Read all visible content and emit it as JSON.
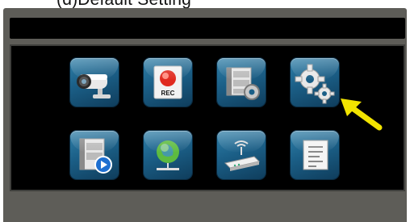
{
  "caption": "(d)Default Setting",
  "menu": {
    "rec_label": "REC",
    "items": [
      {
        "icon": "camera-icon"
      },
      {
        "icon": "record-icon"
      },
      {
        "icon": "record-settings-icon"
      },
      {
        "icon": "gear-icon"
      },
      {
        "icon": "playback-icon"
      },
      {
        "icon": "network-icon"
      },
      {
        "icon": "wireless-router-icon"
      },
      {
        "icon": "device-info-icon"
      }
    ]
  },
  "colors": {
    "tile_top": "#2f7fa8",
    "tile_bottom": "#0f3d5c",
    "panel": "#5e5d58",
    "arrow": "#f2e400"
  }
}
